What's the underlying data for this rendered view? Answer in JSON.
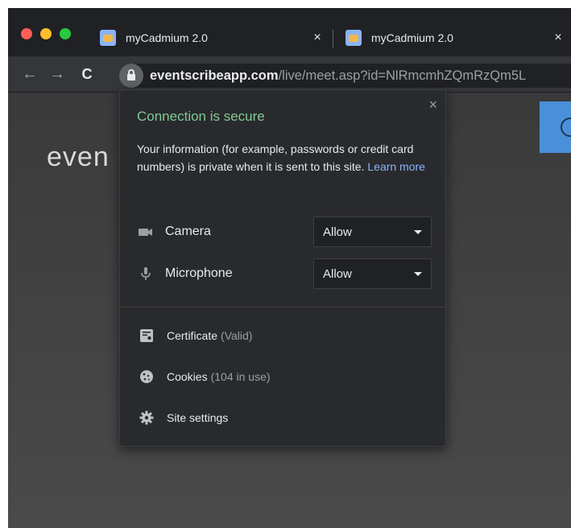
{
  "tabs": [
    {
      "title": "myCadmium 2.0",
      "close": "×",
      "active": true
    },
    {
      "title": "myCadmium 2.0",
      "close": "×",
      "active": false
    }
  ],
  "toolbar": {
    "back_icon": "←",
    "forward_icon": "→",
    "reload_icon": "C",
    "url_host": "eventscribeapp.com",
    "url_path": "/live/meet.asp?id=NlRmcmhZQmRzQm5L"
  },
  "page": {
    "logo_text": "even"
  },
  "popup": {
    "close": "×",
    "title": "Connection is secure",
    "description": "Your information (for example, passwords or credit card numbers) is private when it is sent to this site.",
    "learn_more": "Learn more",
    "permissions": [
      {
        "label": "Camera",
        "value": "Allow",
        "icon": "camera-icon"
      },
      {
        "label": "Microphone",
        "value": "Allow",
        "icon": "microphone-icon"
      }
    ],
    "links": [
      {
        "label": "Certificate",
        "sub": "(Valid)",
        "icon": "certificate-icon"
      },
      {
        "label": "Cookies",
        "sub": "(104 in use)",
        "icon": "cookie-icon"
      },
      {
        "label": "Site settings",
        "sub": "",
        "icon": "gear-icon"
      }
    ]
  },
  "colors": {
    "secure_green": "#81c995",
    "link_blue": "#8ab4f8",
    "popup_bg": "#292a2d",
    "toolbar_bg": "#35363a"
  }
}
